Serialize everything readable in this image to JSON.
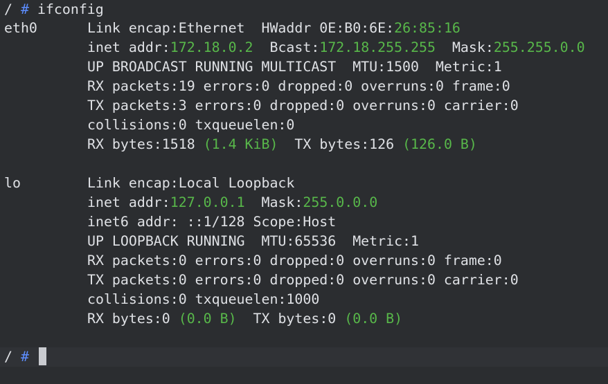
{
  "prompt": {
    "path": "/",
    "symbol": "#",
    "command": "ifconfig"
  },
  "interfaces": [
    {
      "name": "eth0",
      "encap": "Link encap:Ethernet",
      "hw_label": "HWaddr 0E:B0:6E:",
      "hw_tail": "26:85:16",
      "inet_label": "inet addr:",
      "inet_addr": "172.18.0.2",
      "bcast_label": "Bcast:",
      "bcast": "172.18.255.255",
      "mask_label": "Mask:",
      "mask": "255.255.0.0",
      "flags": "UP BROADCAST RUNNING MULTICAST  MTU:1500  Metric:1",
      "rx_packets": "RX packets:19 errors:0 dropped:0 overruns:0 frame:0",
      "tx_packets": "TX packets:3 errors:0 dropped:0 overruns:0 carrier:0",
      "collisions": "collisions:0 txqueuelen:0",
      "rx_bytes_label": "RX bytes:1518 ",
      "rx_bytes_hr": "(1.4 KiB)",
      "tx_bytes_label": "TX bytes:126 ",
      "tx_bytes_hr": "(126.0 B)"
    },
    {
      "name": "lo",
      "encap": "Link encap:Local Loopback",
      "inet_label": "inet addr:",
      "inet_addr": "127.0.0.1",
      "mask_label": "Mask:",
      "mask": "255.0.0.0",
      "inet6": "inet6 addr: ::1/128 Scope:Host",
      "flags": "UP LOOPBACK RUNNING  MTU:65536  Metric:1",
      "rx_packets": "RX packets:0 errors:0 dropped:0 overruns:0 frame:0",
      "tx_packets": "TX packets:0 errors:0 dropped:0 overruns:0 carrier:0",
      "collisions": "collisions:0 txqueuelen:1000",
      "rx_bytes_label": "RX bytes:0 ",
      "rx_bytes_hr": "(0.0 B)",
      "tx_bytes_label": "TX bytes:0 ",
      "tx_bytes_hr": "(0.0 B)"
    }
  ],
  "colors": {
    "background": "#2b2d30",
    "foreground": "#dfe1e5",
    "value_green": "#58b84a",
    "prompt_blue": "#5c8dff",
    "cursor": "#c9cbd0"
  }
}
